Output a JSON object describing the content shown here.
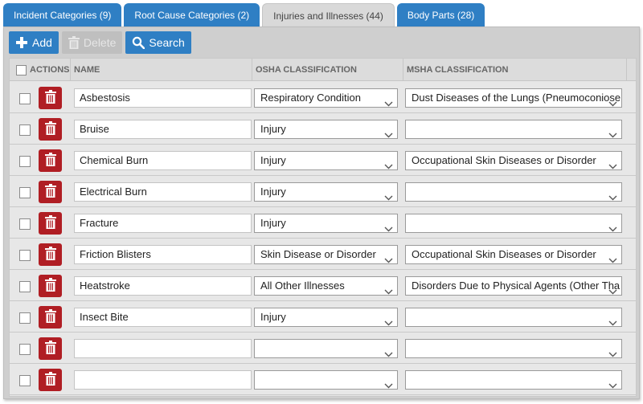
{
  "tabs": [
    {
      "label": "Incident Categories (9)",
      "active": false
    },
    {
      "label": "Root Cause Categories (2)",
      "active": false
    },
    {
      "label": "Injuries and Illnesses (44)",
      "active": true
    },
    {
      "label": "Body Parts (28)",
      "active": false
    }
  ],
  "toolbar": {
    "add_label": "Add",
    "delete_label": "Delete",
    "search_label": "Search"
  },
  "grid": {
    "headers": {
      "actions": "ACTIONS",
      "name": "NAME",
      "osha": "OSHA CLASSIFICATION",
      "msha": "MSHA CLASSIFICATION"
    },
    "rows": [
      {
        "name": "Asbestosis",
        "osha": "Respiratory Condition",
        "msha": "Dust Diseases of the Lungs (Pneumoconiose"
      },
      {
        "name": "Bruise",
        "osha": "Injury",
        "msha": ""
      },
      {
        "name": "Chemical Burn",
        "osha": "Injury",
        "msha": "Occupational Skin Diseases or Disorder"
      },
      {
        "name": "Electrical Burn",
        "osha": "Injury",
        "msha": ""
      },
      {
        "name": "Fracture",
        "osha": "Injury",
        "msha": ""
      },
      {
        "name": "Friction Blisters",
        "osha": "Skin Disease or Disorder",
        "msha": "Occupational Skin Diseases or Disorder"
      },
      {
        "name": "Heatstroke",
        "osha": "All Other Illnesses",
        "msha": "Disorders Due to Physical Agents (Other Tha"
      },
      {
        "name": "Insect Bite",
        "osha": "Injury",
        "msha": ""
      },
      {
        "name": "",
        "osha": "",
        "msha": ""
      },
      {
        "name": "",
        "osha": "",
        "msha": ""
      }
    ]
  },
  "colors": {
    "tab_blue": "#2f7fc4",
    "delete_red": "#b01e24",
    "panel_gray": "#cfcfcf"
  },
  "icons": {
    "add": "plus-icon",
    "delete": "trash-icon",
    "search": "search-icon",
    "select": "chevron-down-icon"
  }
}
